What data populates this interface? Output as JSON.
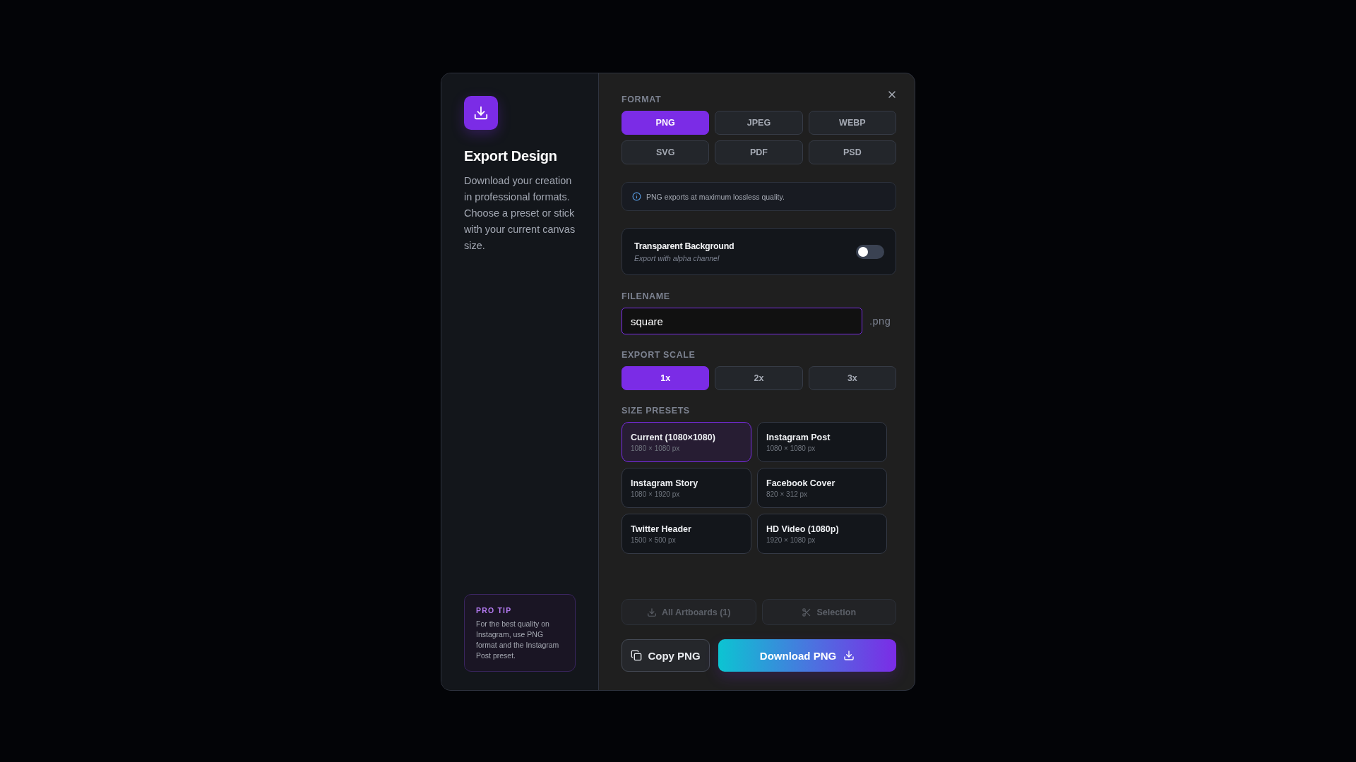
{
  "dialog": {
    "title": "Export Design",
    "description": "Download your creation in professional formats. Choose a preset or stick with your current canvas size.",
    "pro_tip": {
      "label": "PRO TIP",
      "text": "For the best quality on Instagram, use PNG format and the Instagram Post preset."
    }
  },
  "format": {
    "label": "FORMAT",
    "options": [
      {
        "label": "PNG",
        "selected": true
      },
      {
        "label": "JPEG",
        "selected": false
      },
      {
        "label": "WEBP",
        "selected": false
      },
      {
        "label": "SVG",
        "selected": false
      },
      {
        "label": "PDF",
        "selected": false
      },
      {
        "label": "PSD",
        "selected": false
      }
    ],
    "info": "PNG exports at maximum lossless quality."
  },
  "transparent_background": {
    "title": "Transparent Background",
    "subtitle": "Export with alpha channel",
    "on": false
  },
  "filename": {
    "label": "FILENAME",
    "value": "square",
    "extension": ".png"
  },
  "export_scale": {
    "label": "EXPORT SCALE",
    "options": [
      {
        "label": "1x",
        "selected": true
      },
      {
        "label": "2x",
        "selected": false
      },
      {
        "label": "3x",
        "selected": false
      }
    ]
  },
  "size_presets": {
    "label": "SIZE PRESETS",
    "presets": [
      {
        "name": "Current (1080×1080)",
        "size": "1080 × 1080 px",
        "selected": true
      },
      {
        "name": "Instagram Post",
        "size": "1080 × 1080 px",
        "selected": false
      },
      {
        "name": "Instagram Story",
        "size": "1080 × 1920 px",
        "selected": false
      },
      {
        "name": "Facebook Cover",
        "size": "820 × 312 px",
        "selected": false
      },
      {
        "name": "Twitter Header",
        "size": "1500 × 500 px",
        "selected": false
      },
      {
        "name": "HD Video (1080p)",
        "size": "1920 × 1080 px",
        "selected": false
      }
    ]
  },
  "secondary_actions": [
    {
      "label": "All Artboards (1)",
      "kind": "artboards",
      "disabled": true
    },
    {
      "label": "Selection",
      "kind": "selection",
      "disabled": true
    }
  ],
  "copy_button": "Copy PNG",
  "download_button": "Download PNG"
}
